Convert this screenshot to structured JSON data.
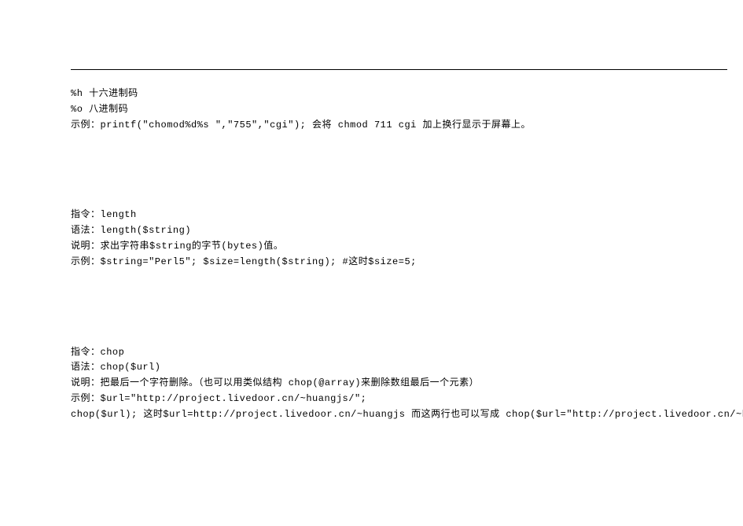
{
  "block1": {
    "l1": "%h 十六进制码",
    "l2": "%o 八进制码",
    "l3": "示例：printf(\"chomod%d%s \",\"755\",\"cgi\"); 会将 chmod 711 cgi 加上换行显示于屏幕上。"
  },
  "block2": {
    "l1": "指令：length",
    "l2": "语法：length($string)",
    "l3": "说明：求出字符串$string的字节(bytes)值。",
    "l4": "示例：$string=\"Perl5\"; $size=length($string); #这时$size=5;"
  },
  "block3": {
    "l1": "指令：chop",
    "l2": "语法：chop($url)",
    "l3": "说明：把最后一个字符删除。（也可以用类似结构 chop(@array)来删除数组最后一个元素）",
    "l4": "示例：$url=\"http://project.livedoor.cn/~huangjs/\";",
    "l5": "chop($url); 这时$url=http://project.livedoor.cn/~huangjs 而这两行也可以写成 chop($url=\"http://project.livedoor.cn/~huangjs/\");"
  }
}
